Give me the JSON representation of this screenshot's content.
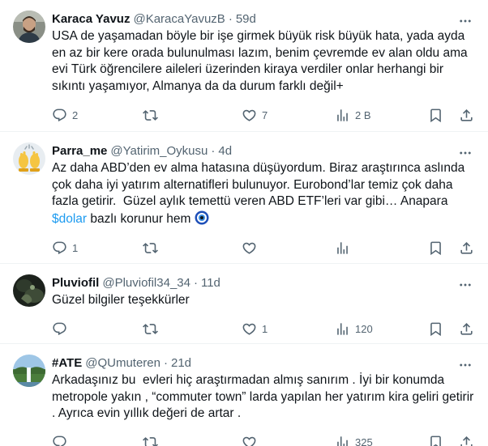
{
  "tweets": [
    {
      "name": "Karaca Yavuz",
      "handle": "@KaracaYavuzB",
      "time": "59d",
      "text": "USA de yaşamadan böyle bir işe girmek büyük risk büyük hata, yada ayda en az bir kere orada bulunulması lazım, benim çevremde ev alan oldu ama evi Türk öğrencilere aileleri üzerinden kiraya verdiler onlar herhangi bir sıkıntı yaşamıyor, Almanya da da durum farklı değil+",
      "replies": "2",
      "retweets": "",
      "likes": "7",
      "views": "2 B",
      "avatar": "man-portrait"
    },
    {
      "name": "Parra_me",
      "handle": "@Yatirim_Oykusu",
      "time": "4d",
      "text_before": "Az daha ABD’den ev alma hatasına düşüyordum. Biraz araştırınca aslında çok daha iyi yatırım alternatifleri bulunuyor. Eurobond’lar temiz çok daha fazla getirir.  Güzel aylık temettü veren ABD ETF’leri var gibi… Anapara ",
      "cashtag": "$dolar",
      "text_after": " bazlı korunur hem ",
      "replies": "1",
      "retweets": "",
      "likes": "",
      "views": "",
      "avatar": "raised-hands-emoji"
    },
    {
      "name": "Pluviofil",
      "handle": "@Pluviofil34_34",
      "time": "11d",
      "text": "Güzel bilgiler teşekkürler",
      "replies": "",
      "retweets": "",
      "likes": "1",
      "views": "120",
      "avatar": "dark-photo"
    },
    {
      "name": "#ATE",
      "handle": "@QUmuteren",
      "time": "21d",
      "text": "Arkadaşınız bu  evleri hiç araştırmadan almış sanırım . İyi bir konumda metropole yakın , “commuter town” larda yapılan her yatırım kira geliri getirir . Ayrıca evin yıllık değeri de artar .",
      "replies": "",
      "retweets": "",
      "likes": "",
      "views": "325",
      "avatar": "waterfall-landscape"
    }
  ],
  "icons": {
    "reply": "reply-icon",
    "retweet": "retweet-icon",
    "like": "heart-icon",
    "views": "views-icon",
    "bookmark": "bookmark-icon",
    "share": "share-icon",
    "more": "more-icon"
  },
  "colors": {
    "text": "#0f1419",
    "secondary": "#536471",
    "link": "#1d9bf0",
    "border": "#eff3f4"
  }
}
